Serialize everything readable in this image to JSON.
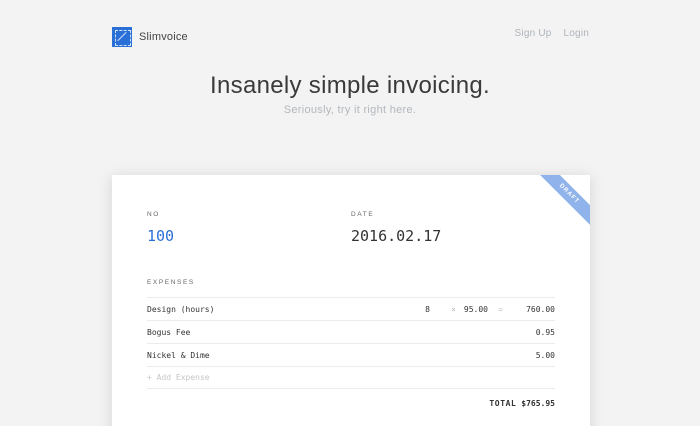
{
  "brand": {
    "name": "Slimvoice",
    "logo_icon": "slimvoice-logo-icon",
    "accent": "#2a6fd6"
  },
  "nav": {
    "signup": "Sign Up",
    "login": "Login"
  },
  "hero": {
    "title": "Insanely simple invoicing.",
    "subtitle": "Seriously, try it right here."
  },
  "invoice": {
    "ribbon": "DRAFT",
    "no_label": "NO",
    "no_value": "100",
    "date_label": "DATE",
    "date_value": "2016.02.17",
    "expenses_label": "EXPENSES",
    "rows": [
      {
        "description": "Design (hours)",
        "qty": "8",
        "times": "×",
        "rate": "95.00",
        "equals": "=",
        "amount": "760.00"
      },
      {
        "description": "Bogus Fee",
        "amount": "0.95"
      },
      {
        "description": "Nickel & Dime",
        "amount": "5.00"
      }
    ],
    "add_expense": "+ Add Expense",
    "total_label": "TOTAL",
    "total_value": "$765.95"
  }
}
